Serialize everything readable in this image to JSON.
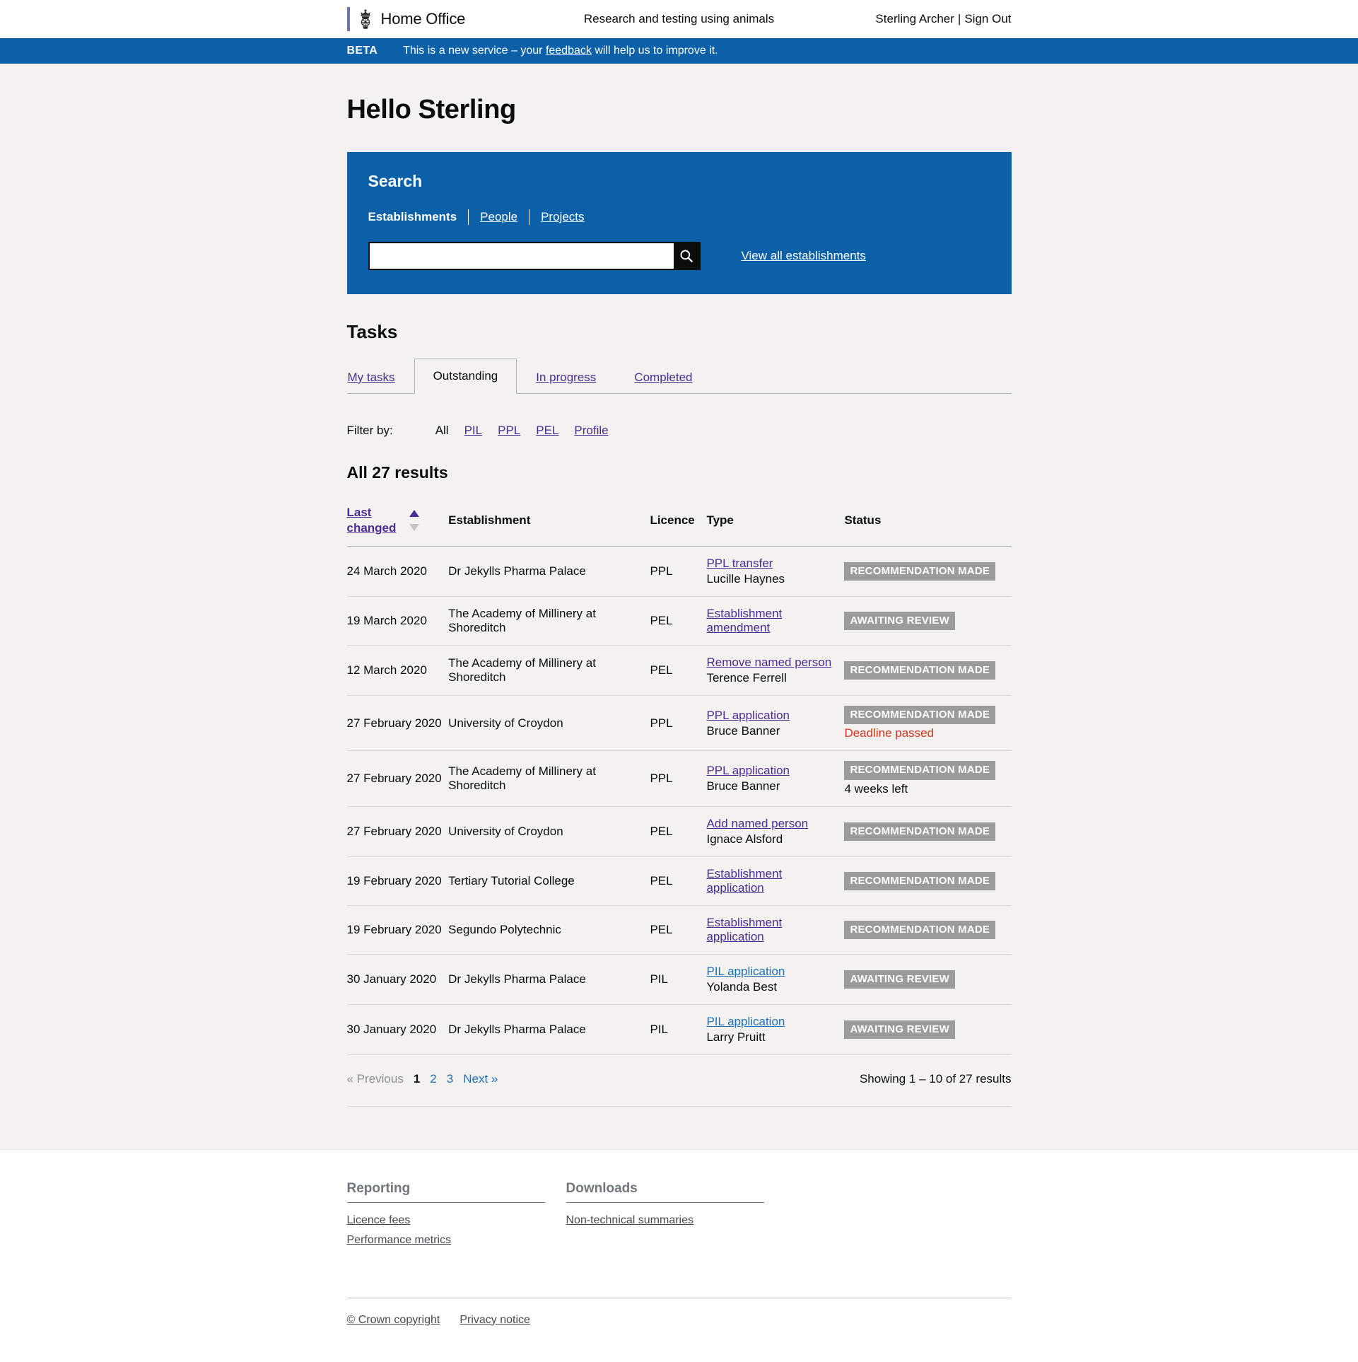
{
  "header": {
    "brand": "Home Office",
    "service_name": "Research and testing using animals",
    "user_name": "Sterling Archer",
    "separator": "|",
    "sign_out": "Sign Out"
  },
  "phase_banner": {
    "tag": "BETA",
    "text_before": "This is a new service – your ",
    "link": "feedback",
    "text_after": " will help us to improve it."
  },
  "page": {
    "title": "Hello Sterling"
  },
  "search": {
    "heading": "Search",
    "tabs": [
      {
        "label": "Establishments",
        "active": true
      },
      {
        "label": "People",
        "active": false
      },
      {
        "label": "Projects",
        "active": false
      }
    ],
    "input_value": "",
    "placeholder": "",
    "submit_icon": "search-icon",
    "view_all_label": "View all establishments"
  },
  "tasks": {
    "heading": "Tasks",
    "tabs": [
      {
        "label": "My tasks",
        "selected": false
      },
      {
        "label": "Outstanding",
        "selected": true
      },
      {
        "label": "In progress",
        "selected": false
      },
      {
        "label": "Completed",
        "selected": false
      }
    ],
    "filter_label": "Filter by:",
    "filters": [
      {
        "label": "All",
        "active": true
      },
      {
        "label": "PIL",
        "active": false
      },
      {
        "label": "PPL",
        "active": false
      },
      {
        "label": "PEL",
        "active": false
      },
      {
        "label": "Profile",
        "active": false
      }
    ],
    "results_heading": "All 27 results",
    "columns": {
      "last_changed": "Last changed",
      "establishment": "Establishment",
      "licence": "Licence",
      "type": "Type",
      "status": "Status"
    },
    "sort": {
      "direction": "ascending",
      "up_icon": "sort-ascending-icon",
      "down_icon": "sort-descending-icon"
    },
    "rows": [
      {
        "date": "24 March 2020",
        "establishment": "Dr Jekylls Pharma Palace",
        "licence": "PPL",
        "type_link": "PPL transfer",
        "type_link_style": "visited",
        "person": "Lucille Haynes",
        "status": "RECOMMENDATION MADE",
        "deadline": "",
        "deadline_passed": false
      },
      {
        "date": "19 March 2020",
        "establishment": "The Academy of Millinery at Shoreditch",
        "licence": "PEL",
        "type_link": "Establishment amendment",
        "type_link_style": "visited",
        "person": "",
        "status": "AWAITING REVIEW",
        "deadline": "",
        "deadline_passed": false
      },
      {
        "date": "12 March 2020",
        "establishment": "The Academy of Millinery at Shoreditch",
        "licence": "PEL",
        "type_link": "Remove named person",
        "type_link_style": "visited",
        "person": "Terence Ferrell",
        "status": "RECOMMENDATION MADE",
        "deadline": "",
        "deadline_passed": false
      },
      {
        "date": "27 February 2020",
        "establishment": "University of Croydon",
        "licence": "PPL",
        "type_link": "PPL application",
        "type_link_style": "visited",
        "person": "Bruce Banner",
        "status": "RECOMMENDATION MADE",
        "deadline": "Deadline passed",
        "deadline_passed": true
      },
      {
        "date": "27 February 2020",
        "establishment": "The Academy of Millinery at Shoreditch",
        "licence": "PPL",
        "type_link": "PPL application",
        "type_link_style": "visited",
        "person": "Bruce Banner",
        "status": "RECOMMENDATION MADE",
        "deadline": "4 weeks left",
        "deadline_passed": false
      },
      {
        "date": "27 February 2020",
        "establishment": "University of Croydon",
        "licence": "PEL",
        "type_link": "Add named person",
        "type_link_style": "visited",
        "person": "Ignace Alsford",
        "status": "RECOMMENDATION MADE",
        "deadline": "",
        "deadline_passed": false
      },
      {
        "date": "19 February 2020",
        "establishment": "Tertiary Tutorial College",
        "licence": "PEL",
        "type_link": "Establishment application",
        "type_link_style": "visited",
        "person": "",
        "status": "RECOMMENDATION MADE",
        "deadline": "",
        "deadline_passed": false
      },
      {
        "date": "19 February 2020",
        "establishment": "Segundo Polytechnic",
        "licence": "PEL",
        "type_link": "Establishment application",
        "type_link_style": "visited",
        "person": "",
        "status": "RECOMMENDATION MADE",
        "deadline": "",
        "deadline_passed": false
      },
      {
        "date": "30 January 2020",
        "establishment": "Dr Jekylls Pharma Palace",
        "licence": "PIL",
        "type_link": "PIL application",
        "type_link_style": "unvisited",
        "person": "Yolanda Best",
        "status": "AWAITING REVIEW",
        "deadline": "",
        "deadline_passed": false
      },
      {
        "date": "30 January 2020",
        "establishment": "Dr Jekylls Pharma Palace",
        "licence": "PIL",
        "type_link": "PIL application",
        "type_link_style": "unvisited",
        "person": "Larry Pruitt",
        "status": "AWAITING REVIEW",
        "deadline": "",
        "deadline_passed": false
      }
    ],
    "pagination": {
      "previous": "« Previous",
      "pages": [
        {
          "label": "1",
          "current": true
        },
        {
          "label": "2",
          "current": false
        },
        {
          "label": "3",
          "current": false
        }
      ],
      "next": "Next »",
      "showing": "Showing 1 – 10 of 27 results"
    }
  },
  "footer": {
    "columns": [
      {
        "heading": "Reporting",
        "links": [
          "Licence fees",
          "Performance metrics"
        ]
      },
      {
        "heading": "Downloads",
        "links": [
          "Non-technical summaries"
        ]
      }
    ],
    "legal": [
      "© Crown copyright",
      "Privacy notice"
    ]
  },
  "colors": {
    "brand_blue": "#0b60a8",
    "link_purple": "#4c2c92",
    "link_blue": "#1d70b8",
    "badge_grey": "#9b9b9b",
    "error_red": "#d4351c",
    "page_bg": "#f3f2f1"
  }
}
